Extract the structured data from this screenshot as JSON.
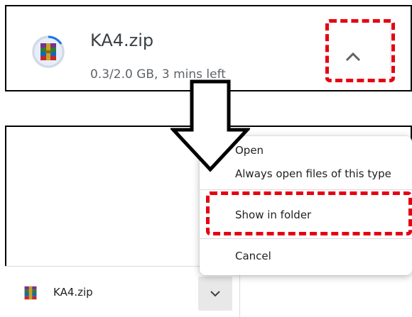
{
  "download_card": {
    "filename": "KA4.zip",
    "status": "0.3/2.0 GB, 3 mins left",
    "progress_fraction": 0.15,
    "expand_icon": "chevron-up-icon",
    "file_icon": "winrar-archive-icon"
  },
  "context_menu": {
    "items": [
      {
        "label": "Open"
      },
      {
        "label": "Always open files of this type"
      },
      {
        "label": "Show in folder"
      },
      {
        "label": "Cancel"
      }
    ]
  },
  "download_shelf": {
    "filename": "KA4.zip",
    "menu_icon": "chevron-down-icon"
  },
  "colors": {
    "highlight": "#e60012",
    "progress": "#1a73e8",
    "text": "#3c4043",
    "muted": "#5f6368"
  }
}
